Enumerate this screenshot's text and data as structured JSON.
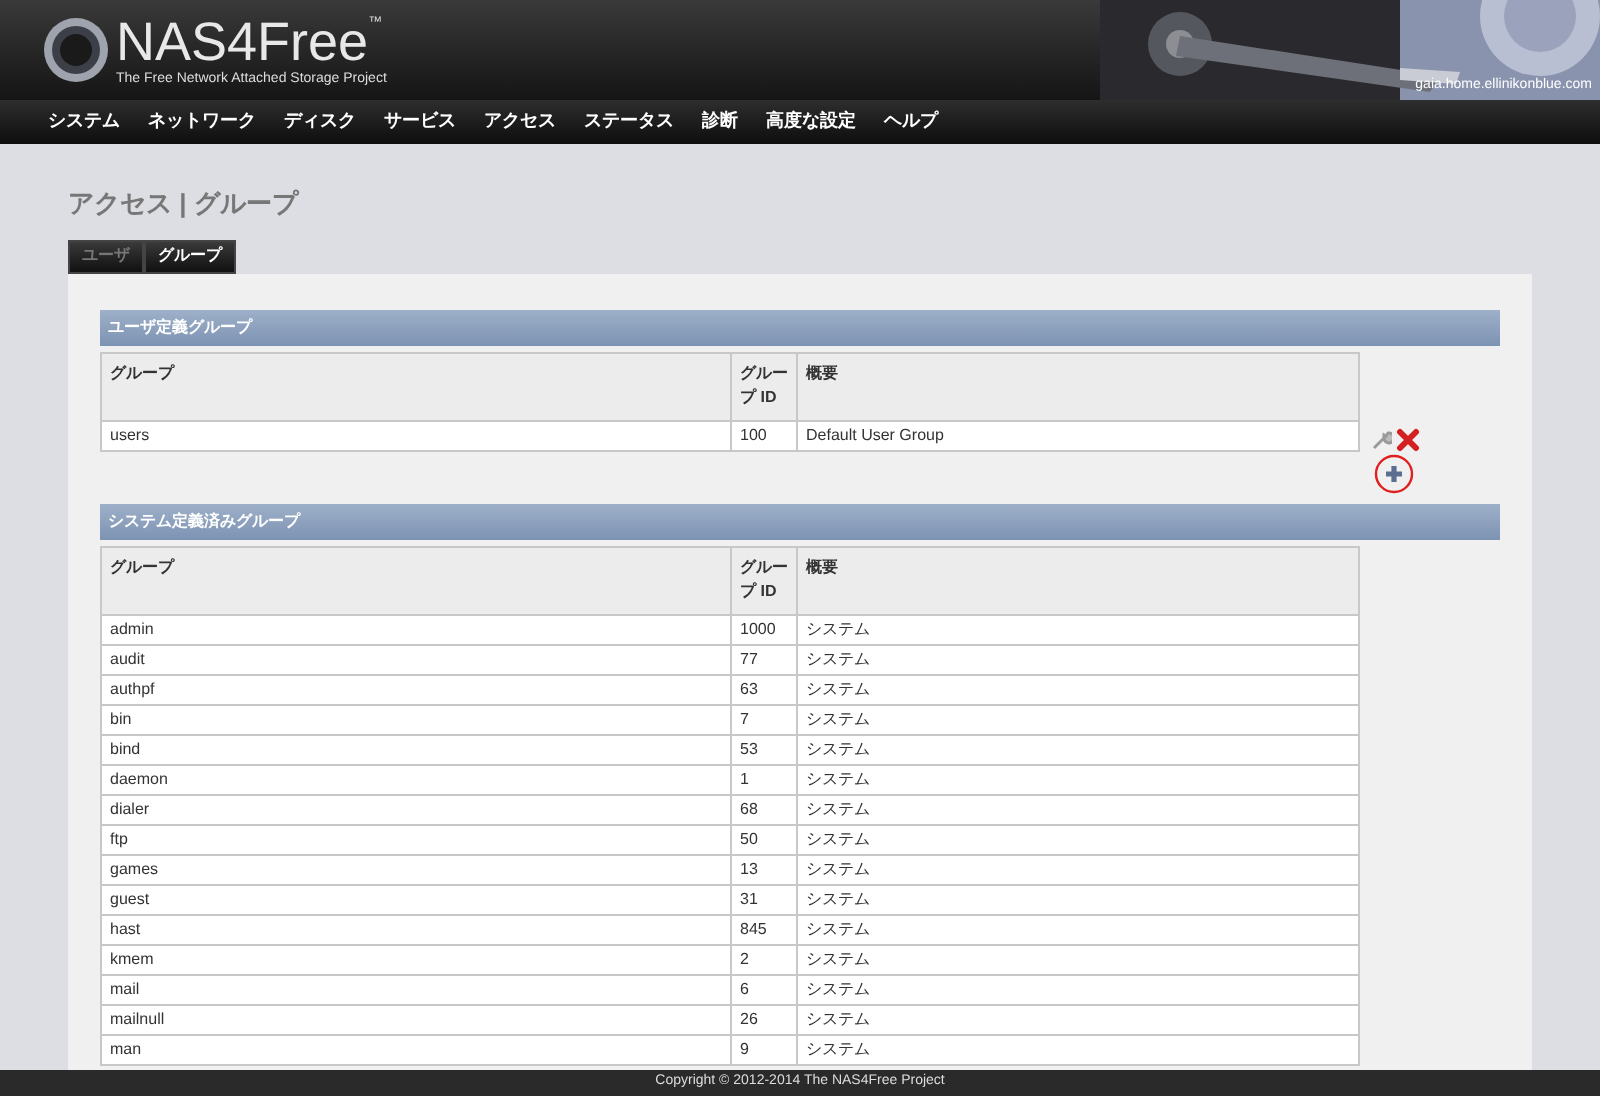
{
  "header": {
    "logo": "NAS4Free",
    "trademark": "™",
    "tagline": "The Free Network Attached Storage Project",
    "hostname": "gaia.home.ellinikonblue.com"
  },
  "nav": [
    "システム",
    "ネットワーク",
    "ディスク",
    "サービス",
    "アクセス",
    "ステータス",
    "診断",
    "高度な設定",
    "ヘルプ"
  ],
  "page_title": "アクセス | グループ",
  "tabs": [
    {
      "label": "ユーザ",
      "selected": false
    },
    {
      "label": "グループ",
      "selected": true
    }
  ],
  "user_groups": {
    "title": "ユーザ定義グループ",
    "columns": [
      "グループ",
      "グループ ID",
      "概要"
    ],
    "rows": [
      {
        "group": "users",
        "id": "100",
        "description": "Default User Group"
      }
    ]
  },
  "system_groups": {
    "title": "システム定義済みグループ",
    "columns": [
      "グループ",
      "グループ ID",
      "概要"
    ],
    "rows": [
      {
        "group": "admin",
        "id": "1000",
        "description": "システム"
      },
      {
        "group": "audit",
        "id": "77",
        "description": "システム"
      },
      {
        "group": "authpf",
        "id": "63",
        "description": "システム"
      },
      {
        "group": "bin",
        "id": "7",
        "description": "システム"
      },
      {
        "group": "bind",
        "id": "53",
        "description": "システム"
      },
      {
        "group": "daemon",
        "id": "1",
        "description": "システム"
      },
      {
        "group": "dialer",
        "id": "68",
        "description": "システム"
      },
      {
        "group": "ftp",
        "id": "50",
        "description": "システム"
      },
      {
        "group": "games",
        "id": "13",
        "description": "システム"
      },
      {
        "group": "guest",
        "id": "31",
        "description": "システム"
      },
      {
        "group": "hast",
        "id": "845",
        "description": "システム"
      },
      {
        "group": "kmem",
        "id": "2",
        "description": "システム"
      },
      {
        "group": "mail",
        "id": "6",
        "description": "システム"
      },
      {
        "group": "mailnull",
        "id": "26",
        "description": "システム"
      },
      {
        "group": "man",
        "id": "9",
        "description": "システム"
      }
    ]
  },
  "footer": "Copyright © 2012-2014 The NAS4Free Project"
}
